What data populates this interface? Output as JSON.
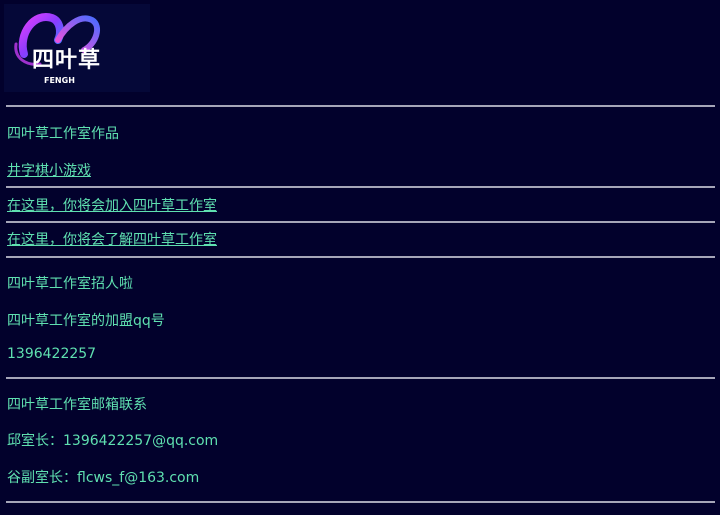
{
  "logo": {
    "title": "四叶草",
    "subtitle": "FENGH",
    "accent_colors": [
      "#d23cf0",
      "#7a3cff",
      "#2d8cff"
    ]
  },
  "heading": "四叶草工作室作品",
  "links": [
    {
      "label": "井字棋小游戏"
    },
    {
      "label": "在这里，你将会加入四叶草工作室"
    },
    {
      "label": "在这里，你将会了解四叶草工作室"
    }
  ],
  "recruit": {
    "title": "四叶草工作室招人啦",
    "qq_label": "四叶草工作室的加盟qq号",
    "qq_number": "1396422257"
  },
  "contact": {
    "title": "四叶草工作室邮箱联系",
    "chief": "邱室长：1396422257@qq.com",
    "deputy": "谷副室长：flcws_f@163.com"
  },
  "colors": {
    "background": "#02012c",
    "text": "#5fe0b0",
    "divider": "#a6a6b8"
  }
}
